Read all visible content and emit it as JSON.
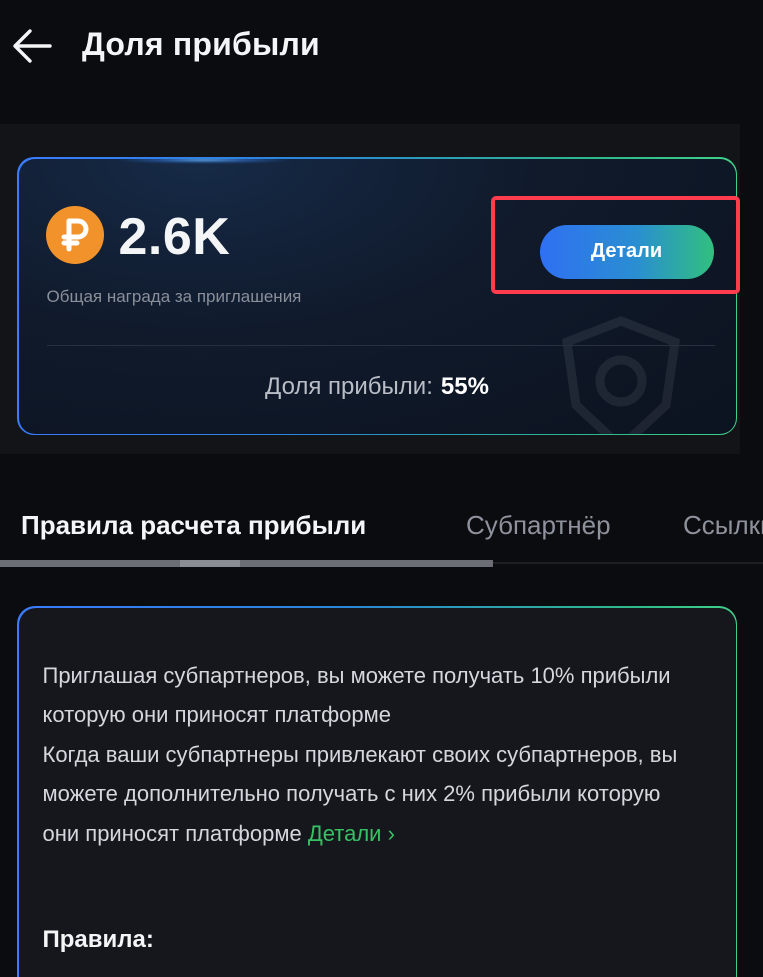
{
  "header": {
    "title": "Доля прибыли"
  },
  "reward": {
    "currency_symbol": "₽",
    "amount": "2.6K",
    "caption": "Общая награда за приглашения",
    "details_button": "Детали",
    "profit_share_label": "Доля прибыли:",
    "profit_share_value": "55%"
  },
  "tabs": [
    {
      "label": "Правила расчета прибыли",
      "active": true
    },
    {
      "label": "Субпартнёр",
      "active": false
    },
    {
      "label": "Ссылки",
      "active": false
    }
  ],
  "rules": {
    "paragraph_1": "Приглашая субпартнеров, вы можете получать 10% прибыли которую они приносят платформе",
    "paragraph_2": "Когда ваши субпартнеры привлекают своих субпартнеров, вы можете дополнительно получать с них 2% прибыли которую они приносят платформе",
    "link_label": "Детали",
    "link_chevron": "›",
    "heading": "Правила:"
  },
  "colors": {
    "background": "#0b0c0f",
    "accent_blue": "#2f70f2",
    "accent_green": "#31c07e",
    "coin_orange": "#f2922b",
    "highlight_red": "#ff3b4e",
    "link_green": "#35c264"
  },
  "icons": {
    "back": "arrow-left-icon",
    "coin": "ruble-coin-icon",
    "watermark": "crest-watermark-icon",
    "link_chevron": "chevron-right-icon"
  }
}
